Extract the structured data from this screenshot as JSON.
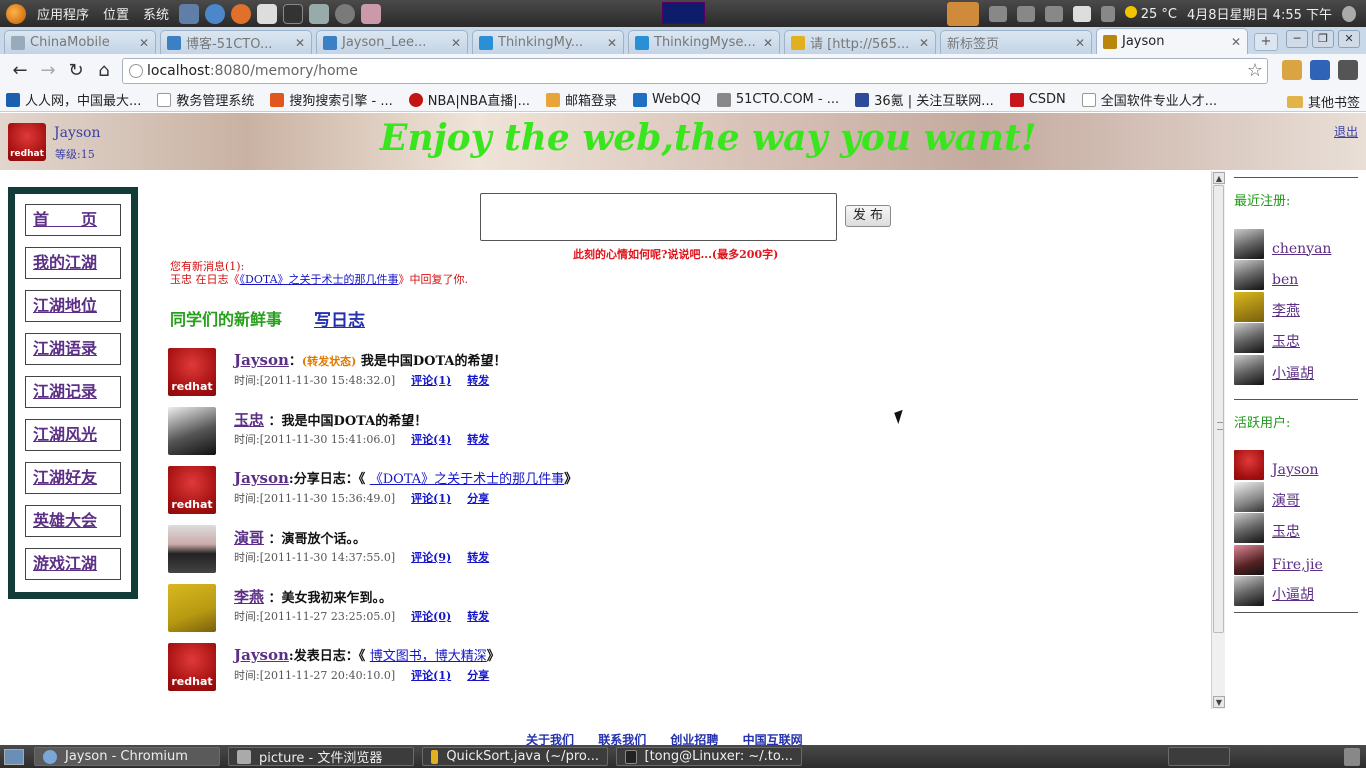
{
  "gnome_top": {
    "menus": [
      "应用程序",
      "位置",
      "系统"
    ],
    "temperature": "25 °C",
    "datetime": "4月8日星期日  4:55 下午"
  },
  "browser": {
    "tabs": [
      {
        "label": "ChinaMobile"
      },
      {
        "label": "博客-51CTO..."
      },
      {
        "label": "Jayson_Lee..."
      },
      {
        "label": "ThinkingMy..."
      },
      {
        "label": "ThinkingMyse..."
      },
      {
        "label": "请 [http://565..."
      },
      {
        "label": "新标签页"
      },
      {
        "label": "Jayson"
      }
    ],
    "url_host": "localhost",
    "url_path": ":8080/memory/home",
    "bookmarks": [
      {
        "label": "人人网，中国最大..."
      },
      {
        "label": "教务管理系统"
      },
      {
        "label": "搜狗搜索引擎 - ..."
      },
      {
        "label": "NBA|NBA直播|..."
      },
      {
        "label": "邮箱登录"
      },
      {
        "label": "WebQQ"
      },
      {
        "label": "51CTO.COM - ..."
      },
      {
        "label": "36氪 | 关注互联网..."
      },
      {
        "label": "CSDN"
      },
      {
        "label": "全国软件专业人才..."
      }
    ],
    "other_bookmarks": "其他书签"
  },
  "header": {
    "username": "Jayson",
    "level": "等级:15",
    "slogan": "Enjoy the web,the way you want!",
    "logout": "退出"
  },
  "nav": [
    "首　　页",
    "我的江湖",
    "江湖地位",
    "江湖语录",
    "江湖记录",
    "江湖风光",
    "江湖好友",
    "英雄大会",
    "游戏江湖"
  ],
  "composer": {
    "button": "发 布",
    "hint": "此刻的心情如何呢?说说吧...(最多200字)"
  },
  "notice": {
    "title": "您有新消息(1):",
    "body_prefix": "玉忠 在日志《",
    "body_link": "《DOTA》之关于术士的那几件事",
    "body_suffix": "》中回复了你."
  },
  "feed": {
    "heading": "同学们的新鲜事",
    "write_log": "写日志",
    "items": [
      {
        "who": "Jayson",
        "mid": "：",
        "repost": "(转发状态)",
        "text": "  我是中国DOTA的希望！",
        "link": "",
        "tail": "",
        "time": "时间:[2011-11-30 15:48:32.0]",
        "comment": "评论(1)",
        "action": "转发"
      },
      {
        "who": "玉忠",
        "mid": " ：",
        "repost": "",
        "text": "我是中国DOTA的希望！",
        "link": "",
        "tail": "",
        "time": "时间:[2011-11-30 15:41:06.0]",
        "comment": "评论(4)",
        "action": "转发"
      },
      {
        "who": "Jayson",
        "mid": ":",
        "repost": "",
        "text": "分享日志：《 ",
        "link": "《DOTA》之关于术士的那几件事",
        "tail": "》",
        "time": "时间:[2011-11-30 15:36:49.0]",
        "comment": "评论(1)",
        "action": "分享"
      },
      {
        "who": "演哥",
        "mid": " ：",
        "repost": "",
        "text": "演哥放个话。。",
        "link": "",
        "tail": "",
        "time": "时间:[2011-11-30 14:37:55.0]",
        "comment": "评论(9)",
        "action": "转发"
      },
      {
        "who": "李燕",
        "mid": " ：",
        "repost": "",
        "text": "美女我初来乍到。。",
        "link": "",
        "tail": "",
        "time": "时间:[2011-11-27 23:25:05.0]",
        "comment": "评论(0)",
        "action": "转发"
      },
      {
        "who": "Jayson",
        "mid": ":",
        "repost": "",
        "text": "发表日志：《 ",
        "link": "博文图书，博大精深",
        "tail": "》",
        "time": "时间:[2011-11-27 20:40:10.0]",
        "comment": "评论(1)",
        "action": "分享"
      }
    ]
  },
  "sidebar": {
    "recent_title": "最近注册:",
    "recent": [
      "chenyan",
      "ben",
      "李燕",
      "玉忠",
      "小逼胡"
    ],
    "active_title": "活跃用户:",
    "active": [
      "Jayson",
      "演哥",
      "玉忠",
      "Fire,jie",
      "小逼胡"
    ]
  },
  "footer": [
    "关于我们",
    "联系我们",
    "创业招聘",
    "中国互联网"
  ],
  "taskbar": [
    {
      "label": "Jayson - Chromium"
    },
    {
      "label": "picture - 文件浏览器"
    },
    {
      "label": "QuickSort.java (~/pro..."
    },
    {
      "label": "[tong@Linuxer: ~/.to..."
    }
  ]
}
